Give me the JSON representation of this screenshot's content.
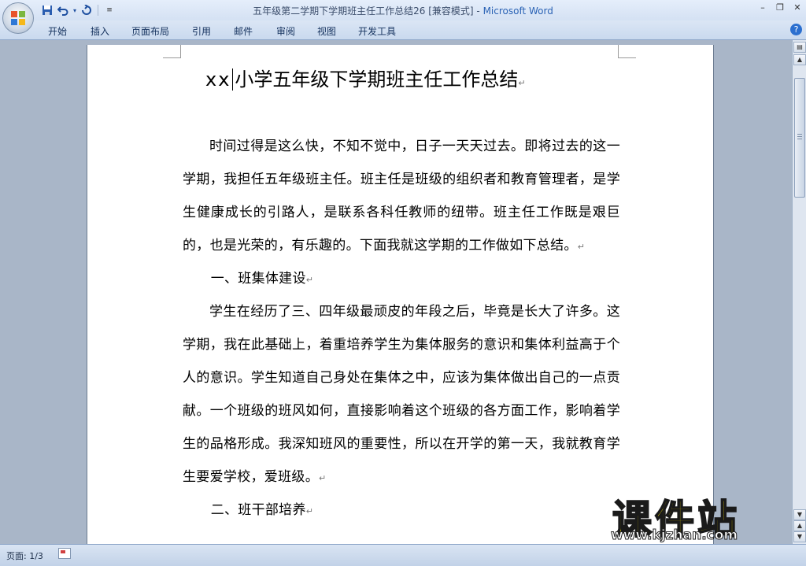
{
  "window": {
    "title": "五年级第二学期下学期班主任工作总结26 [兼容模式]",
    "title_separator": " - ",
    "app_name": "Microsoft Word",
    "controls": [
      "minimize",
      "maximize",
      "close"
    ]
  },
  "quick_access": {
    "icons": [
      "save-icon",
      "undo-icon",
      "undo-dropdown-icon",
      "redo-icon",
      "customize-qat-icon"
    ]
  },
  "ribbon": {
    "tabs": [
      "开始",
      "插入",
      "页面布局",
      "引用",
      "邮件",
      "审阅",
      "视图",
      "开发工具"
    ],
    "help_label": "?"
  },
  "document": {
    "title_prefix": "xx",
    "title_main": "小学五年级下学期班主任工作总结",
    "paragraphs": [
      {
        "type": "body",
        "text": "时间过得是这么快，不知不觉中，日子一天天过去。即将过去的这一学期，我担任五年级班主任。班主任是班级的组织者和教育管理者，是学生健康成长的引路人，是联系各科任教师的纽带。班主任工作既是艰巨的，也是光荣的，有乐趣的。下面我就这学期的工作做如下总结。"
      },
      {
        "type": "head",
        "text": "一、班集体建设"
      },
      {
        "type": "body",
        "text": "学生在经历了三、四年级最顽皮的年段之后，毕竟是长大了许多。这学期，我在此基础上，着重培养学生为集体服务的意识和集体利益高于个人的意识。学生知道自己身处在集体之中，应该为集体做出自己的一点贡献。一个班级的班风如何，直接影响着这个班级的各方面工作，影响着学生的品格形成。我深知班风的重要性，所以在开学的第一天，我就教育学生要爱学校，爱班级。"
      },
      {
        "type": "head",
        "text": "二、班干部培养"
      }
    ],
    "paragraph_mark": "↵"
  },
  "statusbar": {
    "page_info": "页面: 1/3"
  },
  "watermark": {
    "text": "课件站",
    "url": "www.kjzhan.com"
  },
  "colors": {
    "title_blue": "#2b63b5",
    "ribbon_bg": "#c9d9ee",
    "workspace_bg": "#a9b6c8",
    "watermark_yellow": "#f5e100"
  }
}
